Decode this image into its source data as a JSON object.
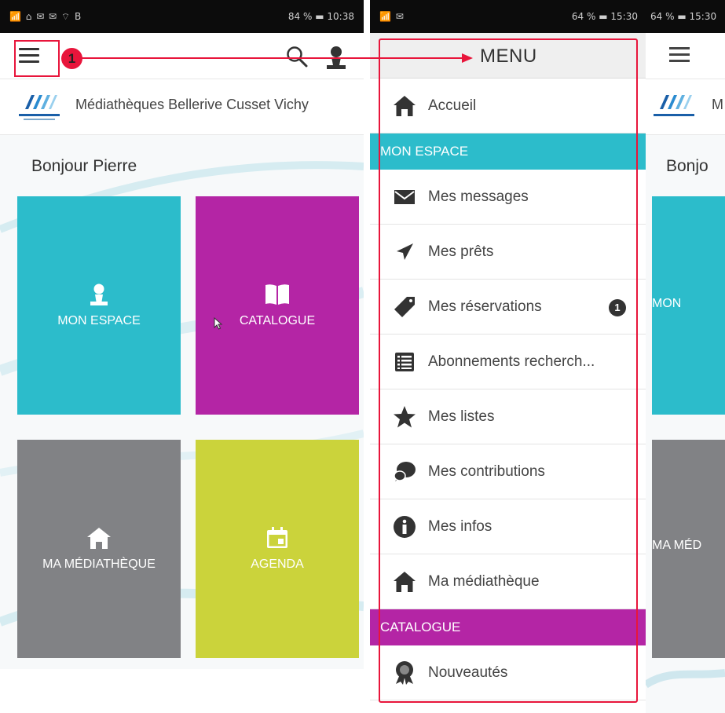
{
  "screen1": {
    "status": {
      "left": "📶 ⌂ ✉ ✉ ⌔ B",
      "battery": "84 %",
      "time": "10:38"
    },
    "callout_number": "1",
    "brand_name": "Médiathèques Bellerive Cusset Vichy",
    "greeting": "Bonjour Pierre",
    "tiles": [
      {
        "label": "MON ESPACE",
        "icon": "person-icon",
        "color": "#2cbccb"
      },
      {
        "label": "CATALOGUE",
        "icon": "book-icon",
        "color": "#b425a5"
      },
      {
        "label": "MA MÉDIATHÈQUE",
        "icon": "home-icon",
        "color": "#818285"
      },
      {
        "label": "AGENDA",
        "icon": "calendar-icon",
        "color": "#cbd33b"
      }
    ]
  },
  "screen2": {
    "status": {
      "left": "📶 ✉",
      "battery": "64 %",
      "time": "15:30"
    },
    "menu_title": "MENU",
    "items": [
      {
        "type": "item",
        "label": "Accueil",
        "icon": "home-icon"
      },
      {
        "type": "section",
        "label": "MON ESPACE",
        "color": "#2cbccb"
      },
      {
        "type": "item",
        "label": "Mes messages",
        "icon": "envelope-icon"
      },
      {
        "type": "item",
        "label": "Mes prêts",
        "icon": "paper-plane-icon"
      },
      {
        "type": "item",
        "label": "Mes réservations",
        "icon": "tag-icon",
        "badge": "1"
      },
      {
        "type": "item",
        "label": "Abonnements recherch...",
        "icon": "list-icon"
      },
      {
        "type": "item",
        "label": "Mes listes",
        "icon": "star-icon"
      },
      {
        "type": "item",
        "label": "Mes contributions",
        "icon": "comments-icon"
      },
      {
        "type": "item",
        "label": "Mes infos",
        "icon": "info-icon"
      },
      {
        "type": "item",
        "label": "Ma médiathèque",
        "icon": "home-icon"
      },
      {
        "type": "section",
        "label": "CATALOGUE",
        "color": "#b425a5"
      },
      {
        "type": "item",
        "label": "Nouveautés",
        "icon": "award-icon"
      }
    ]
  },
  "screen3": {
    "status": {
      "battery": "64 %",
      "time": "15:30"
    },
    "brand_partial": "M",
    "greeting_partial": "Bonjo",
    "tile1_partial": "MON",
    "tile2_partial": "MA MÉD"
  },
  "colors": {
    "accent_red": "#e8153b",
    "espace": "#2cbccb",
    "catalogue": "#b425a5",
    "mediatheque": "#818285",
    "agenda": "#cbd33b"
  }
}
